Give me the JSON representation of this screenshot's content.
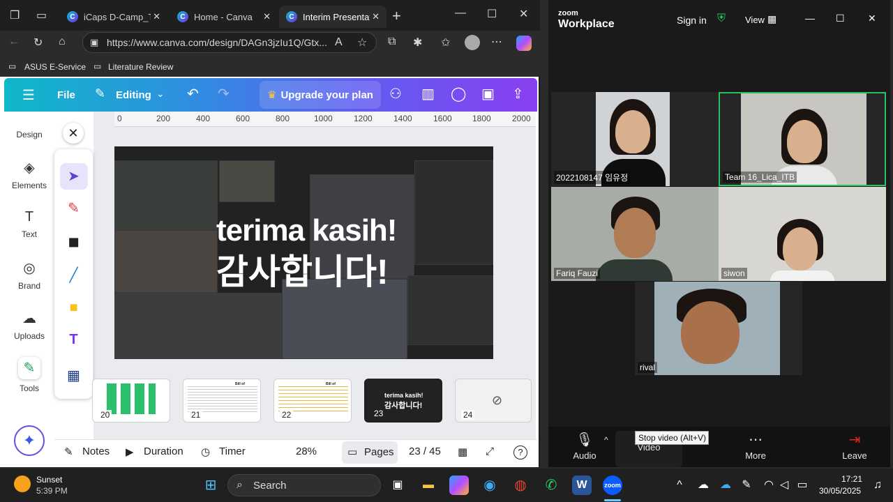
{
  "browser": {
    "tabs": [
      {
        "title": "iCaps D-Camp_Te",
        "icon": "canva-favicon"
      },
      {
        "title": "Home - Canva",
        "icon": "canva-favicon"
      },
      {
        "title": "Interim Presentati",
        "icon": "canva-favicon",
        "active": true
      }
    ],
    "url": "https://www.canva.com/design/DAGn3jzIu1Q/Gtx...",
    "bookmarks": [
      "ASUS E-Service",
      "Literature Review"
    ]
  },
  "canva": {
    "header": {
      "file": "File",
      "editing": "Editing",
      "upgrade": "Upgrade your plan"
    },
    "sidebar": [
      {
        "label": "Design",
        "icon": "design-icon"
      },
      {
        "label": "Elements",
        "icon": "elements-icon"
      },
      {
        "label": "Text",
        "icon": "text-icon"
      },
      {
        "label": "Brand",
        "icon": "brand-icon"
      },
      {
        "label": "Uploads",
        "icon": "uploads-icon"
      },
      {
        "label": "Tools",
        "icon": "tools-icon"
      }
    ],
    "ruler": [
      "0",
      "200",
      "400",
      "600",
      "800",
      "1000",
      "1200",
      "1400",
      "1600",
      "1800",
      "2000"
    ],
    "slide": {
      "line1": "terima kasih!",
      "line2": "감사합니다!"
    },
    "thumbnails": [
      {
        "num": "20"
      },
      {
        "num": "21"
      },
      {
        "num": "22"
      },
      {
        "num": "23",
        "selected": true
      },
      {
        "num": "24"
      }
    ],
    "thumb_texts": {
      "t21": "Bill of Materials",
      "t22": "Bill of Materials",
      "t23a": "terima kasih!",
      "t23b": "감사합니다!"
    },
    "footer": {
      "notes": "Notes",
      "duration": "Duration",
      "timer": "Timer",
      "zoom": "28%",
      "pages": "Pages",
      "page_count": "23 / 45"
    }
  },
  "zoom": {
    "brand_line1": "zoom",
    "brand_line2": "Workplace",
    "sign_in": "Sign in",
    "view": "View",
    "participants": [
      {
        "name": "2022108147 임유정"
      },
      {
        "name": "Team 16_Lica_ITB",
        "active_speaker": true
      },
      {
        "name": "Fariq Fauzi"
      },
      {
        "name": "siwon"
      },
      {
        "name": "rival"
      }
    ],
    "controls": {
      "audio": "Audio",
      "video": "Video",
      "more": "More",
      "leave": "Leave"
    },
    "tooltip": "Stop video (Alt+V)"
  },
  "taskbar": {
    "weather_title": "Sunset",
    "weather_time": "5:39 PM",
    "search": "Search",
    "time": "17:21",
    "date": "30/05/2025"
  },
  "colors": {
    "canva_gradient_start": "#0fb8c9",
    "canva_gradient_end": "#8a3ff1",
    "zoom_active_border": "#22c55e"
  }
}
